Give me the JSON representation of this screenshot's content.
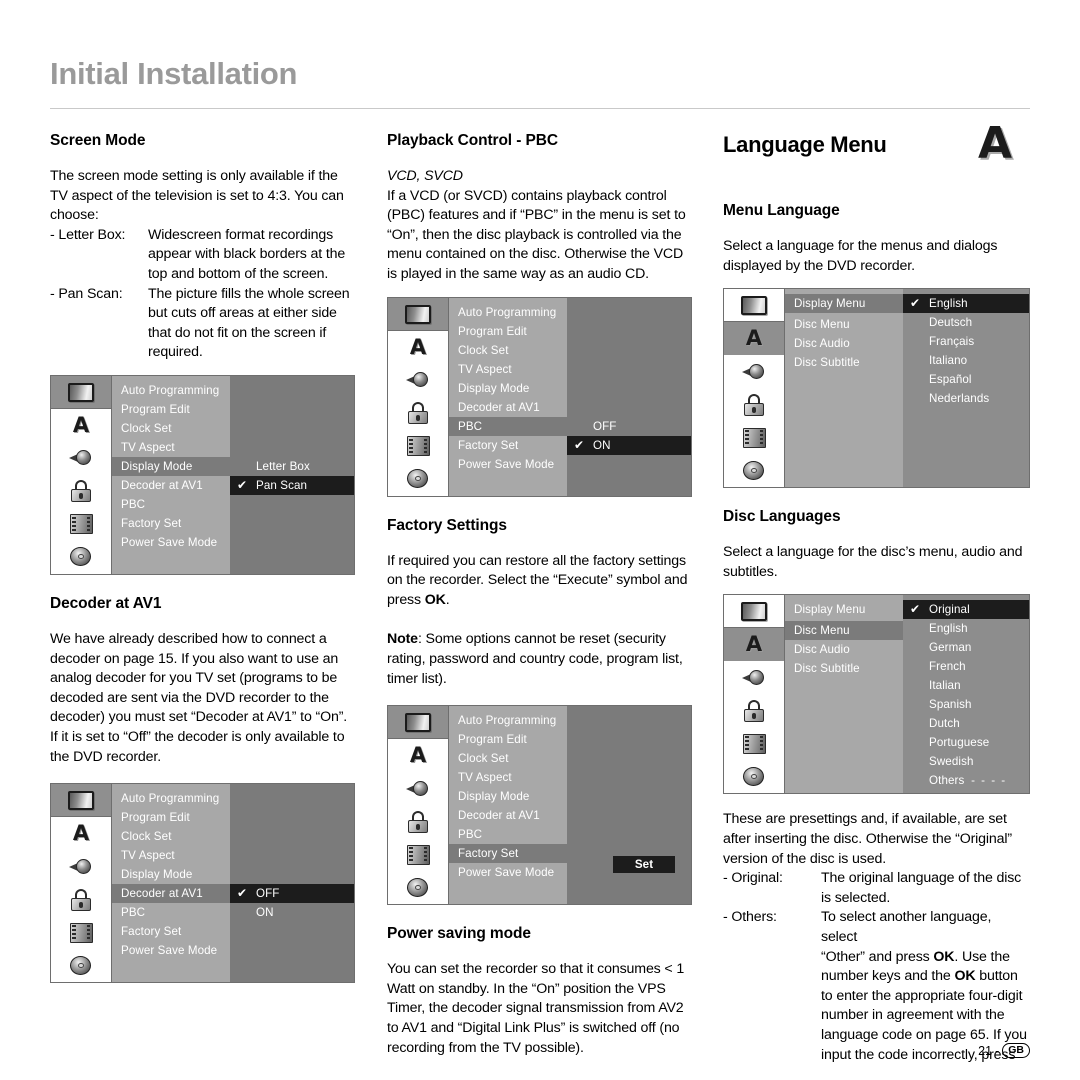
{
  "header": {
    "title": "Initial Installation"
  },
  "footer": {
    "page_number": "21",
    "region_code": "GB",
    "dash": "-"
  },
  "column1": {
    "screen_mode": {
      "heading": "Screen Mode",
      "intro": "The screen mode setting is only available if the TV aspect of the television is set to 4:3. You can choose:",
      "definitions": [
        {
          "term": "- Letter Box:",
          "lines": [
            "Widescreen format recordings",
            "appear with black borders at the",
            "top and bottom of the screen."
          ]
        },
        {
          "term": "- Pan Scan:",
          "lines": [
            "The picture fills the whole screen",
            "but cuts off areas at either side",
            "that do not fit on the screen if",
            "required."
          ]
        }
      ]
    },
    "menu_display_mode": {
      "icons": [
        "tv-icon",
        "letter-a-icon",
        "speaker-icon",
        "lock-icon",
        "film-icon",
        "disc-icon"
      ],
      "active_icon_index": 0,
      "items": [
        "Auto Programming",
        "Program Edit",
        "Clock Set",
        "TV Aspect",
        "Display Mode",
        "Decoder at AV1",
        "PBC",
        "Factory Set",
        "Power Save Mode"
      ],
      "highlighted_item": "Display Mode",
      "options": [
        "Letter Box",
        "Pan Scan"
      ],
      "selected_option": "Pan Scan",
      "check_glyph": "✔"
    },
    "decoder": {
      "heading": "Decoder at AV1",
      "body": "We have already described how to connect a decoder on page 15. If you also want to use an analog decoder for you TV set (programs to be decoded are sent via the DVD recorder to the decoder) you must set “Decoder at AV1” to “On”. If it is set to “Off” the decoder is only available to the DVD recorder."
    },
    "menu_decoder": {
      "items": [
        "Auto Programming",
        "Program Edit",
        "Clock Set",
        "TV Aspect",
        "Display Mode",
        "Decoder at AV1",
        "PBC",
        "Factory Set",
        "Power Save Mode"
      ],
      "highlighted_item": "Decoder at AV1",
      "options": [
        "OFF",
        "ON"
      ],
      "selected_option": "OFF"
    }
  },
  "column2": {
    "pbc": {
      "heading": "Playback Control - PBC",
      "subheading": "VCD, SVCD",
      "body": "If a VCD (or SVCD) contains playback control (PBC) features and if “PBC” in the menu is set to “On”, then the disc playback is controlled via the menu contained on the disc. Otherwise the VCD is played in the same way as an audio CD."
    },
    "menu_pbc": {
      "items": [
        "Auto Programming",
        "Program Edit",
        "Clock Set",
        "TV Aspect",
        "Display Mode",
        "Decoder at AV1",
        "PBC",
        "Factory Set",
        "Power Save Mode"
      ],
      "highlighted_item": "PBC",
      "options": [
        "OFF",
        "ON"
      ],
      "selected_option": "ON"
    },
    "factory": {
      "heading": "Factory Settings",
      "body": "If required you can restore all the factory settings on the recorder. Select the “Execute” symbol and press ",
      "body_bold": "OK",
      "body_tail": ".",
      "note_label": "Note",
      "note_body": ": Some options cannot be reset (security rating, password and country code, program list, timer list)."
    },
    "menu_factory": {
      "items": [
        "Auto Programming",
        "Program Edit",
        "Clock Set",
        "TV Aspect",
        "Display Mode",
        "Decoder at AV1",
        "PBC",
        "Factory Set",
        "Power Save Mode"
      ],
      "highlighted_item": "Factory Set",
      "button_label": "Set"
    },
    "power_saving": {
      "heading": "Power saving mode",
      "body": "You can set the recorder so that it consumes < 1 Watt on standby. In the “On” position the VPS Timer, the decoder signal transmission from AV2 to AV1 and “Digital Link Plus” is switched off (no recording from the TV possible)."
    }
  },
  "column3": {
    "title": "Language Menu",
    "badge_letter": "A",
    "menu_language": {
      "heading": "Menu Language",
      "body": "Select a language for the menus and dialogs displayed by the DVD recorder.",
      "items": [
        "Display Menu",
        "Disc Menu",
        "Disc Audio",
        "Disc Subtitle"
      ],
      "highlighted_item": "Display Menu",
      "options": [
        "English",
        "Deutsch",
        "Français",
        "Italiano",
        "Español",
        "Nederlands"
      ],
      "selected_option": "English",
      "active_icon_index": 1
    },
    "disc_languages": {
      "heading": "Disc Languages",
      "body": "Select a language for the disc’s menu, audio and subtitles.",
      "items": [
        "Display Menu",
        "Disc Menu",
        "Disc Audio",
        "Disc Subtitle"
      ],
      "highlighted_item": "Disc Menu",
      "options": [
        "Original",
        "English",
        "German",
        "French",
        "Italian",
        "Spanish",
        "Dutch",
        "Portuguese",
        "Swedish",
        "Others"
      ],
      "others_dashes": "- - - -",
      "selected_option": "Original",
      "active_icon_index": 1
    },
    "presettings": {
      "intro": "These are presettings and, if available, are set after inserting the disc. Otherwise the “Original” version of the disc is used.",
      "definitions": [
        {
          "term": "- Original:",
          "lines": [
            "The original language of the disc",
            "is selected."
          ]
        },
        {
          "term": "- Others:",
          "lines": [
            "To select another language, select",
            "“Other” and press OK. Use the",
            "number keys and the OK button",
            "to enter the appropriate four-digit",
            "number in agreement with the",
            "language code on page 65. If you",
            "input the code incorrectly, press"
          ]
        }
      ]
    }
  }
}
